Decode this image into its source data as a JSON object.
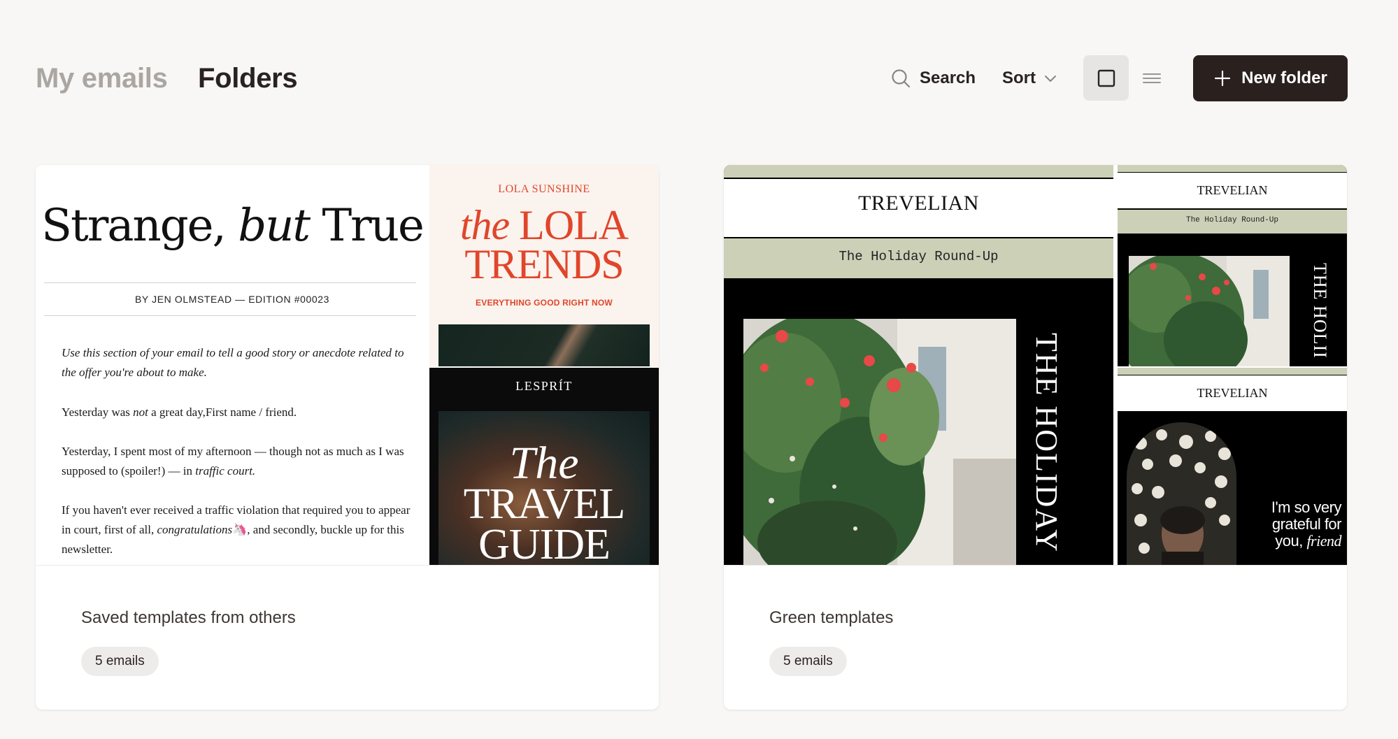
{
  "header": {
    "tabs": [
      {
        "label": "My emails",
        "active": false
      },
      {
        "label": "Folders",
        "active": true
      }
    ],
    "search_label": "Search",
    "sort_label": "Sort",
    "view_modes": {
      "selected": "grid",
      "options": [
        "grid",
        "list"
      ]
    },
    "new_folder_label": "New folder"
  },
  "folders": [
    {
      "name": "Saved templates from others",
      "count_label": "5 emails",
      "preview": {
        "main": {
          "title_part1": "Strange, ",
          "title_italic": "but",
          "title_part2": " True",
          "byline": "BY JEN OLMSTEAD — EDITION #00023",
          "para1": "Use this section of your email to tell a good story or anecdote related to the offer you're about to make.",
          "para2_a": "Yesterday was ",
          "para2_italic": "not",
          "para2_b": " a great day,First name / friend.",
          "para3_a": "Yesterday, I spent most of my afternoon — though not as much as I was supposed to (spoiler!) — in ",
          "para3_italic": "traffic court.",
          "para4_a": "If you haven't ever received a traffic violation that required you to appear in court, first of all, ",
          "para4_italic": "congratulations",
          "para4_emoji": "🦄",
          "para4_b": ", and secondly, buckle up for this newsletter."
        },
        "lola": {
          "brand": "LOLA SUNSHINE",
          "title_italic": "the",
          "title_line1": " LOLA",
          "title_line2": "TRENDS",
          "tagline": "EVERYTHING GOOD RIGHT NOW"
        },
        "lesprit": {
          "brand": "LESPRÍT",
          "title_line1": "The",
          "title_line2": "TRAVEL",
          "title_line3": "GUIDE"
        }
      }
    },
    {
      "name": "Green templates",
      "count_label": "5 emails",
      "preview": {
        "brand": "TREVELIAN",
        "subject": "The Holiday Round-Up",
        "vertical_text": "THE HOLIDAY",
        "vertical_text_small": "THE HOLII",
        "quote_a": "I'm so very grateful for you, ",
        "quote_italic": "friend"
      }
    }
  ],
  "colors": {
    "page_bg": "#f8f7f5",
    "primary_button": "#2a201e",
    "muted_tab": "#aba6a2",
    "lola_accent": "#e0462b",
    "trevelian_sage": "#cbd0b7"
  }
}
